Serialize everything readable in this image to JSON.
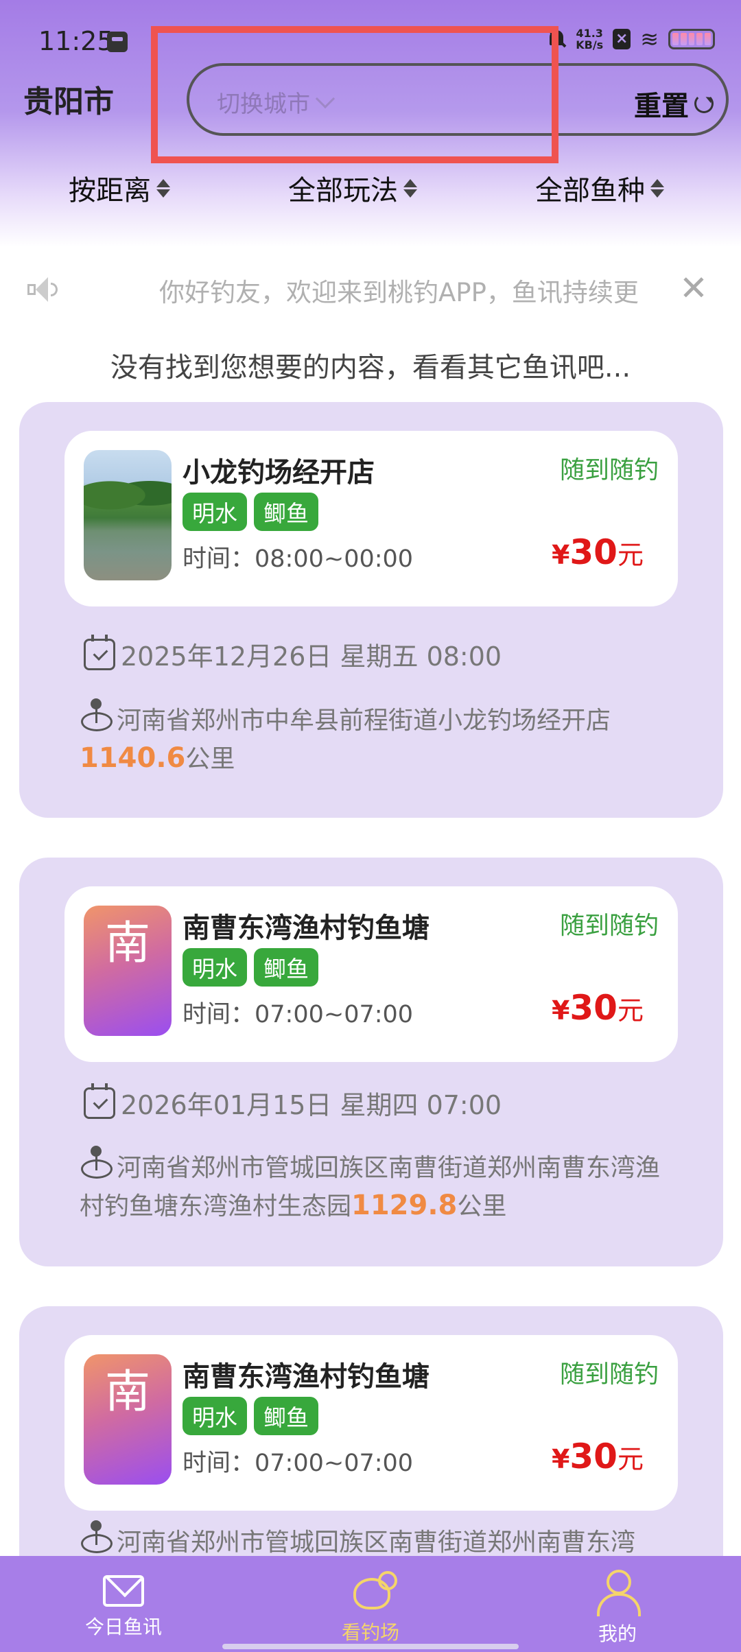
{
  "status_bar": {
    "time": "11:25",
    "net_speed_value": "41.3",
    "net_speed_unit": "KB/s"
  },
  "header": {
    "city": "贵阳市",
    "switch_city_placeholder": "切换城市",
    "reset_label": "重置"
  },
  "filters": {
    "distance": "按距离",
    "play_type": "全部玩法",
    "fish_type": "全部鱼种"
  },
  "notice": {
    "text": "你好钓友，欢迎来到桃钓APP，鱼讯持续更"
  },
  "empty_hint": "没有找到您想要的内容，看看其它鱼讯吧...",
  "venues": [
    {
      "name": "小龙钓场经开店",
      "thumb_text": "",
      "tags": [
        "明水",
        "鲫鱼"
      ],
      "hours_label": "时间：",
      "hours": "08:00~00:00",
      "mode": "随到随钓",
      "price_currency": "¥",
      "price": "30",
      "price_unit": "元",
      "date": "2025年12月26日 星期五 08:00",
      "address": "河南省郑州市中牟县前程街道小龙钓场经开店",
      "distance": "1140.6",
      "distance_unit": "公里"
    },
    {
      "name": "南曹东湾渔村钓鱼塘",
      "thumb_text": "南",
      "tags": [
        "明水",
        "鲫鱼"
      ],
      "hours_label": "时间：",
      "hours": "07:00~07:00",
      "mode": "随到随钓",
      "price_currency": "¥",
      "price": "30",
      "price_unit": "元",
      "date": "2026年01月15日 星期四 07:00",
      "address": "河南省郑州市管城回族区南曹街道郑州南曹东湾渔村钓鱼塘东湾渔村生态园",
      "distance": "1129.8",
      "distance_unit": "公里"
    },
    {
      "name": "南曹东湾渔村钓鱼塘",
      "thumb_text": "南",
      "tags": [
        "明水",
        "鲫鱼"
      ],
      "hours_label": "时间：",
      "hours": "07:00~07:00",
      "mode": "随到随钓",
      "price_currency": "¥",
      "price": "30",
      "price_unit": "元",
      "address": "河南省郑州市管城回族区南曹街道郑州南曹东湾"
    }
  ],
  "bottom_nav": {
    "items": [
      {
        "label": "今日鱼讯",
        "icon": "mail-icon"
      },
      {
        "label": "看钓场",
        "icon": "fish-icon",
        "active": true
      },
      {
        "label": "我的",
        "icon": "user-icon"
      }
    ]
  },
  "colors": {
    "brand_purple": "#a77ee8",
    "card_bg": "#e4dbf5",
    "tag_green": "#38a83c",
    "price_red": "#e01818",
    "distance_orange": "#f08a43",
    "active_nav": "#f5d56a",
    "highlight_red": "#ef5350"
  }
}
